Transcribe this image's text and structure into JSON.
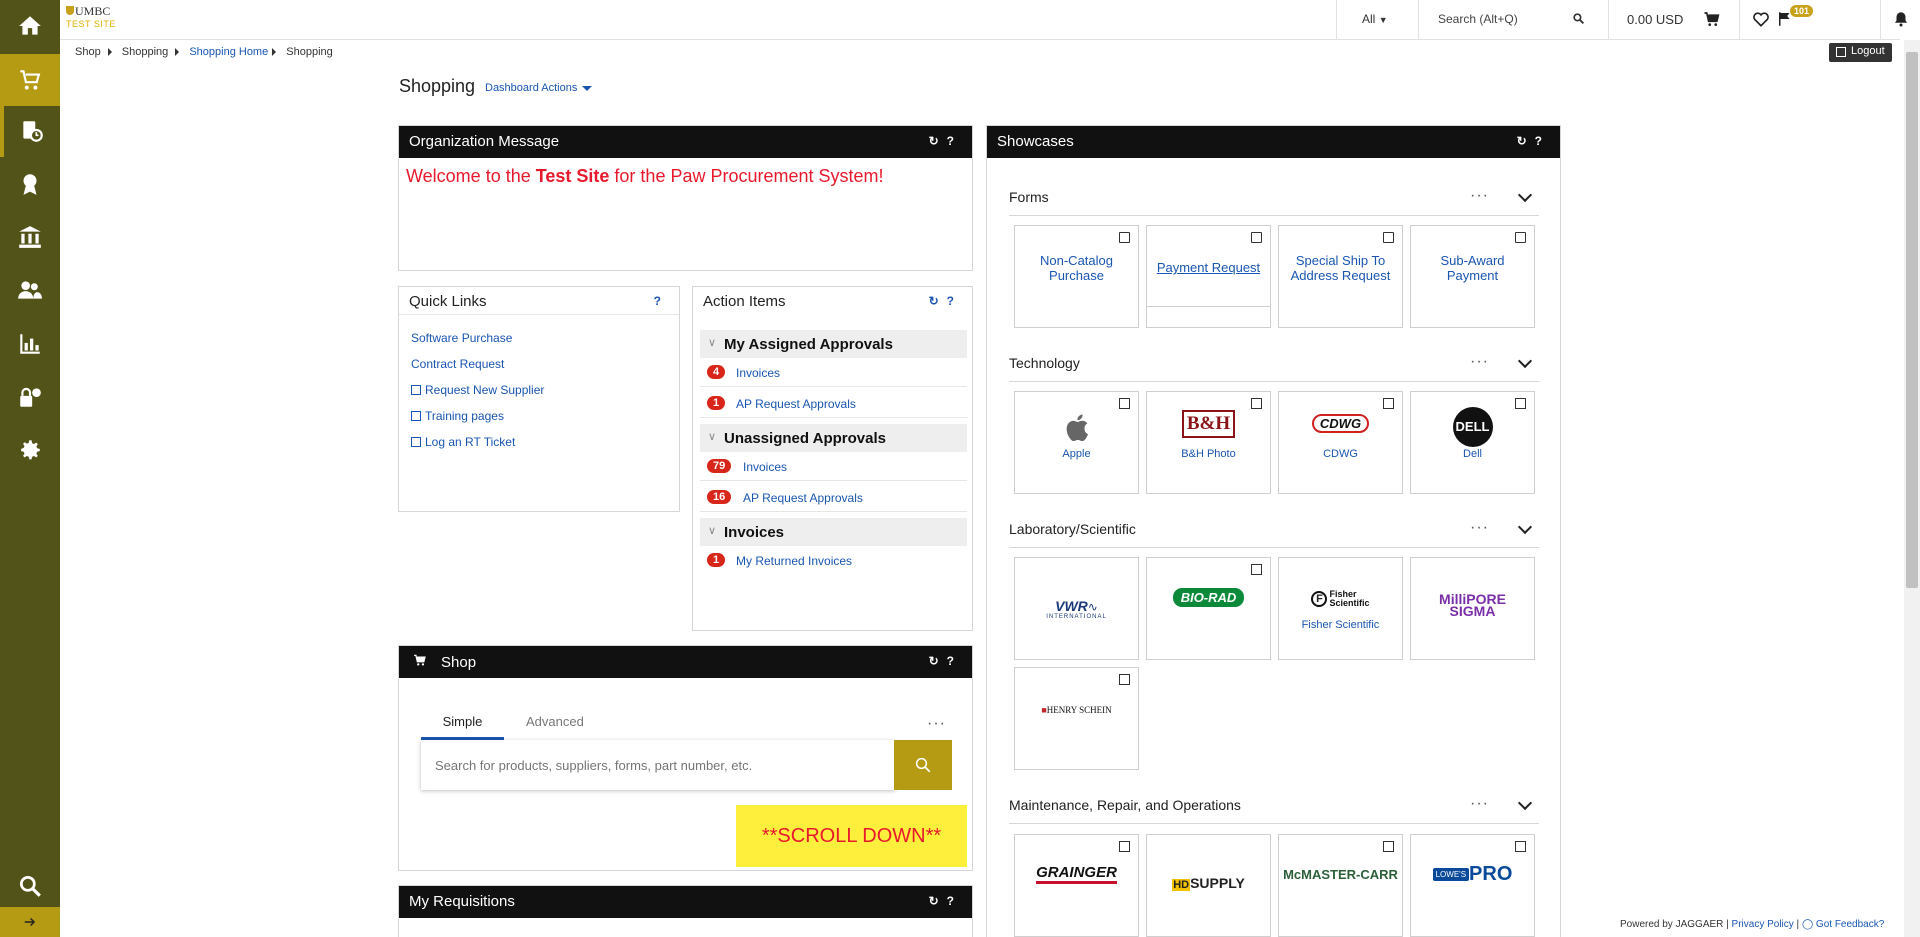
{
  "topbar": {
    "logo_text": "UMBC",
    "logo_sub": "TEST SITE",
    "scope": "All",
    "search_placeholder": "Search (Alt+Q)",
    "cart_total": "0.00 USD",
    "flag_badge": "101"
  },
  "breadcrumb": [
    "Shop",
    "Shopping",
    "Shopping Home",
    "Shopping"
  ],
  "logout_label": "Logout",
  "page": {
    "title": "Shopping",
    "dashboard_actions": "Dashboard Actions"
  },
  "org_message": {
    "title": "Organization Message",
    "text_before": "Welcome to the ",
    "text_bold": "Test Site",
    "text_after": " for the Paw Procurement System!"
  },
  "quick_links": {
    "title": "Quick Links",
    "help": "?",
    "items": [
      {
        "label": "Software Purchase",
        "external": false
      },
      {
        "label": "Contract Request",
        "external": false
      },
      {
        "label": "Request New Supplier",
        "external": true
      },
      {
        "label": "Training pages",
        "external": true
      },
      {
        "label": "Log an RT Ticket",
        "external": true
      }
    ]
  },
  "action_items": {
    "title": "Action Items",
    "groups": [
      {
        "name": "My Assigned Approvals",
        "rows": [
          {
            "count": "4",
            "label": "Invoices"
          },
          {
            "count": "1",
            "label": "AP Request Approvals"
          }
        ]
      },
      {
        "name": "Unassigned Approvals",
        "rows": [
          {
            "count": "79",
            "label": "Invoices"
          },
          {
            "count": "16",
            "label": "AP Request Approvals"
          }
        ]
      },
      {
        "name": "Invoices",
        "rows": [
          {
            "count": "1",
            "label": "My Returned Invoices"
          }
        ]
      }
    ]
  },
  "shop": {
    "title": "Shop",
    "tab_simple": "Simple",
    "tab_advanced": "Advanced",
    "more": "···",
    "placeholder": "Search for products, suppliers, forms, part number, etc.",
    "scroll_note": "**SCROLL DOWN**"
  },
  "my_requisitions": {
    "title": "My Requisitions"
  },
  "showcases": {
    "title": "Showcases",
    "sections": [
      {
        "name": "Forms",
        "tiles": [
          "Non-Catalog Purchase",
          "Payment Request",
          "Special Ship To Address Request",
          "Sub-Award Payment"
        ]
      },
      {
        "name": "Technology",
        "tiles": [
          "Apple",
          "B&H Photo",
          "CDWG",
          "Dell"
        ]
      },
      {
        "name": "Laboratory/Scientific",
        "tiles": [
          "VWR",
          "BIO-RAD",
          "Fisher Scientific",
          "MilliporeSigma",
          "Henry Schein"
        ]
      },
      {
        "name": "Maintenance, Repair, and Operations",
        "tiles": [
          "GRAINGER",
          "HD SUPPLY",
          "McMASTER-CARR",
          "Lowe's PRO"
        ]
      }
    ],
    "tile_labels": {
      "apple": "Apple",
      "bh": "B&H Photo",
      "cdwg": "CDWG",
      "dell": "Dell",
      "fisher": "Fisher Scientific"
    }
  },
  "footer": {
    "powered": "Powered by JAGGAER |",
    "privacy": "Privacy Policy",
    "sep": " | ",
    "feedback": "Got Feedback?"
  },
  "colors": {
    "sidebar": "#525318",
    "accent": "#b59b13",
    "link": "#1a56b0",
    "alert_red": "#e8192c"
  }
}
